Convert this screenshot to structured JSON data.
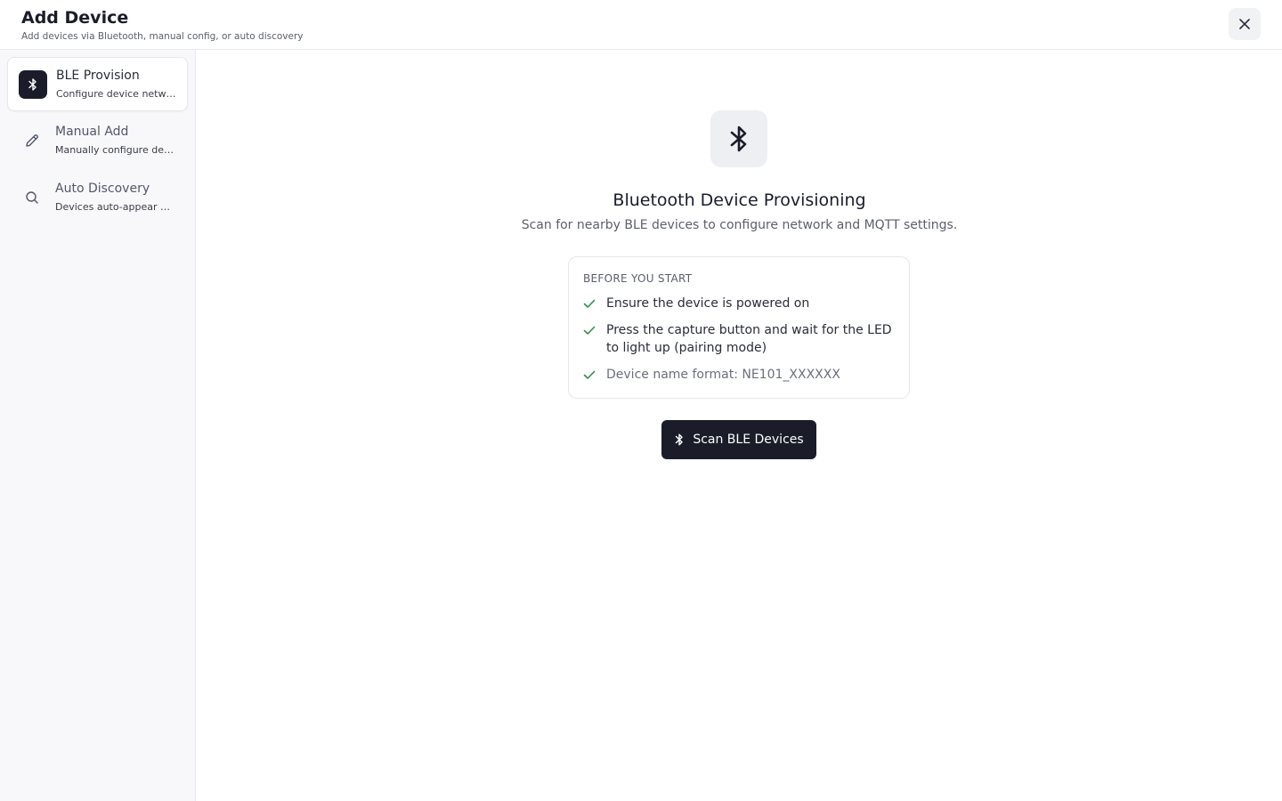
{
  "header": {
    "title": "Add Device",
    "subtitle": "Add devices via Bluetooth, manual config, or auto discovery",
    "close_icon": "close-icon"
  },
  "sidebar": {
    "items": [
      {
        "label": "BLE Provision",
        "desc": "Configure device network via Bluetooth",
        "icon": "bluetooth-icon",
        "active": true
      },
      {
        "label": "Manual Add",
        "desc": "Manually configure device settings",
        "icon": "pencil-icon",
        "active": false
      },
      {
        "label": "Auto Discovery",
        "desc": "Devices auto-appear when online",
        "icon": "search-icon",
        "active": false
      }
    ]
  },
  "main": {
    "hero_icon": "bluetooth-icon",
    "title": "Bluetooth Device Provisioning",
    "subtitle": "Scan for nearby BLE devices to configure network and MQTT settings.",
    "card": {
      "heading": "BEFORE YOU START",
      "items": [
        "Ensure the device is powered on",
        "Press the capture button and wait for the LED to light up (pairing mode)",
        "Device name format: NE101_XXXXXX"
      ]
    },
    "scan_button": "Scan BLE Devices"
  },
  "colors": {
    "primary": "#1a1d29",
    "check": "#2f8f4e",
    "muted": "#5b5f6b"
  }
}
